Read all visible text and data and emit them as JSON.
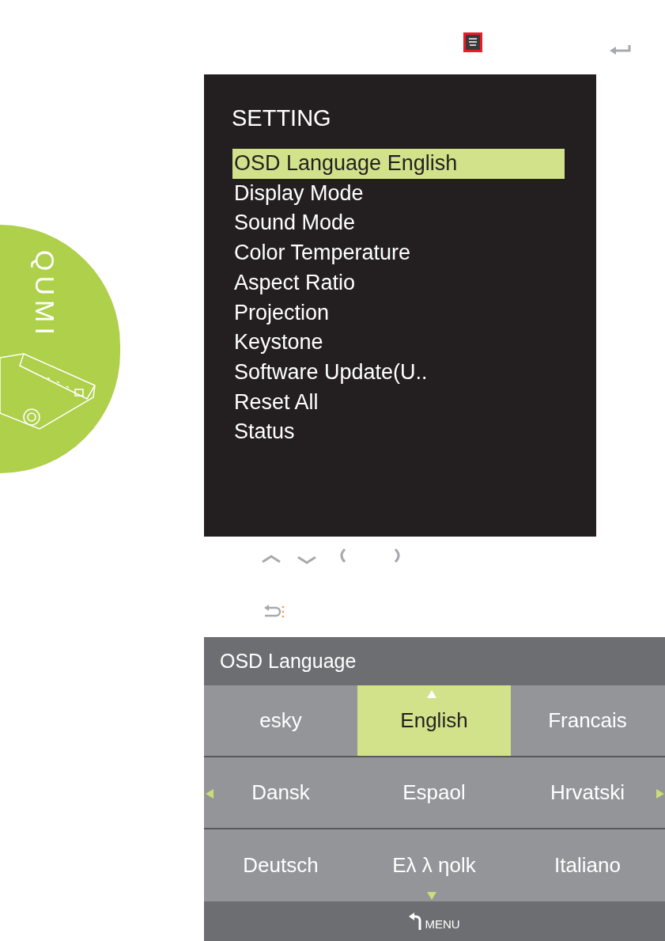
{
  "logo": {
    "text": "QUMI"
  },
  "setting_menu": {
    "title": "SETTING",
    "items": [
      {
        "label": "OSD Language English",
        "selected": true
      },
      {
        "label": "Display Mode",
        "selected": false
      },
      {
        "label": "Sound Mode",
        "selected": false
      },
      {
        "label": "Color Temperature",
        "selected": false
      },
      {
        "label": "Aspect Ratio",
        "selected": false
      },
      {
        "label": "Projection",
        "selected": false
      },
      {
        "label": "Keystone",
        "selected": false
      },
      {
        "label": "Software Update(U..",
        "selected": false
      },
      {
        "label": "Reset All",
        "selected": false
      },
      {
        "label": "Status",
        "selected": false
      }
    ]
  },
  "language_panel": {
    "title": "OSD Language",
    "languages": [
      {
        "label": "esky",
        "selected": false
      },
      {
        "label": "English",
        "selected": true
      },
      {
        "label": "Francais",
        "selected": false
      },
      {
        "label": "Dansk",
        "selected": false
      },
      {
        "label": "Espaol",
        "selected": false
      },
      {
        "label": "Hrvatski",
        "selected": false
      },
      {
        "label": "Deutsch",
        "selected": false
      },
      {
        "label": "Eλ λ ηolk",
        "selected": false
      },
      {
        "label": "Italiano",
        "selected": false
      }
    ],
    "footer": "MENU"
  }
}
